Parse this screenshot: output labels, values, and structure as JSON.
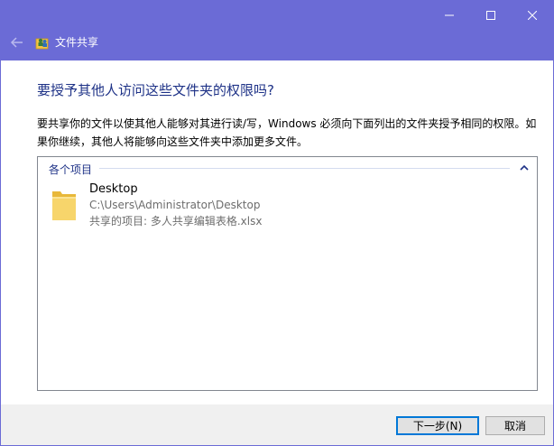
{
  "window": {
    "title": "文件共享",
    "controls": {
      "minimize_icon": "minimize-icon",
      "maximize_icon": "maximize-icon",
      "close_icon": "close-icon"
    },
    "accent_color": "#6b6bd6"
  },
  "content": {
    "heading": "要授予其他人访问这些文件夹的权限吗?",
    "description": "要共享你的文件以使其他人能够对其进行读/写，Windows 必须向下面列出的文件夹授予相同的权限。如果你继续，其他人将能够向这些文件夹中添加更多文件。"
  },
  "list": {
    "group_label": "各个项目",
    "items": [
      {
        "name": "Desktop",
        "path": "C:\\Users\\Administrator\\Desktop",
        "shared": "共享的项目: 多人共享编辑表格.xlsx",
        "icon": "folder-icon"
      }
    ]
  },
  "buttons": {
    "next": "下一步(N)",
    "cancel": "取消"
  }
}
